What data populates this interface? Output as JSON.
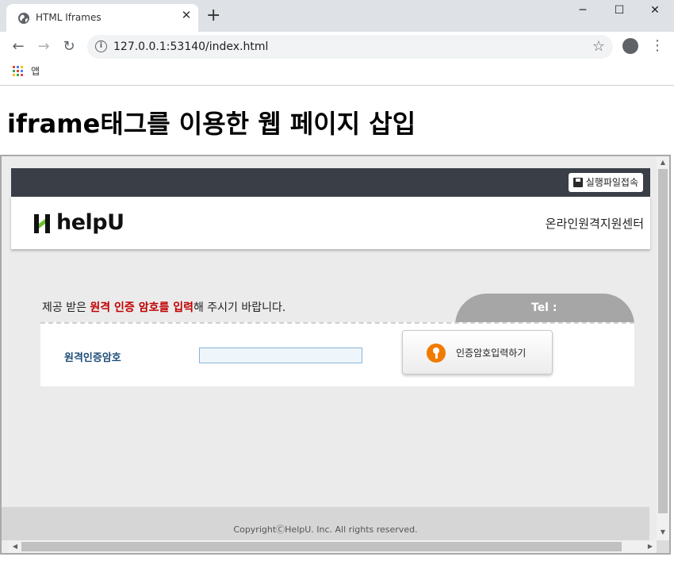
{
  "browser": {
    "tab_title": "HTML Iframes",
    "tab_close": "✕",
    "new_tab": "+",
    "minimize": "─",
    "maximize": "☐",
    "close": "✕",
    "back": "←",
    "forward": "→",
    "reload": "↻",
    "info": "i",
    "url": "127.0.0.1:53140/index.html",
    "bookmark_star": "☆",
    "menu": "⋮",
    "apps_label": "앱"
  },
  "page": {
    "heading": "iframe태그를 이용한 웹 페이지 삽입"
  },
  "iframe": {
    "exec_button": "실행파일접속",
    "logo_text": "helpU",
    "center_name": "온라인원격지원센터",
    "instruction_part1": "제공 받은 ",
    "instruction_highlight": "원격 인증 암호를 입력",
    "instruction_part2": "해 주시기 바랍니다.",
    "tel_label": "Tel :",
    "form_label": "원격인증암호",
    "input_value": "",
    "submit_label": "인증암호입력하기",
    "footer": "CopyrightⒸHelpU. Inc. All rights reserved.",
    "scroll_up": "▲",
    "scroll_down": "▼",
    "scroll_left": "◀",
    "scroll_right": "▶"
  },
  "colors": {
    "accent_red": "#c00000",
    "label_blue": "#1f4e79",
    "key_orange": "#f07b00",
    "topbar": "#3a3e47",
    "tel_tab": "#a6a6a6"
  }
}
